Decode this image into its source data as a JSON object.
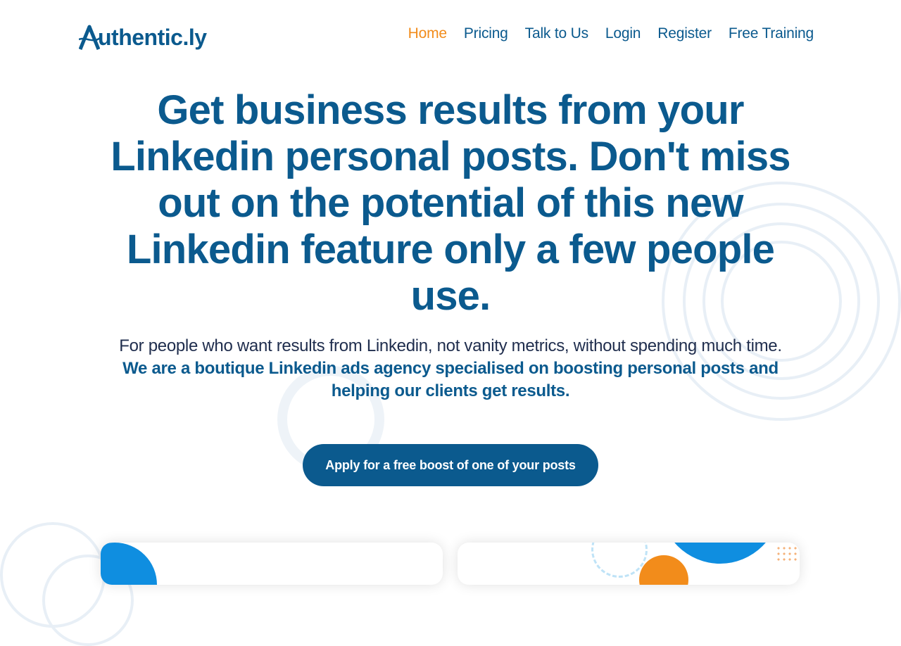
{
  "brand": {
    "name": "Authentic.ly",
    "logo_text_rest": "uthentic.ly",
    "logo_first_letter": "A",
    "primary_color": "#0b5a8e",
    "accent_color": "#f28c1b"
  },
  "nav": {
    "items": [
      {
        "label": "Home",
        "active": true
      },
      {
        "label": "Pricing",
        "active": false
      },
      {
        "label": "Talk to Us",
        "active": false
      },
      {
        "label": "Login",
        "active": false
      },
      {
        "label": "Register",
        "active": false
      },
      {
        "label": "Free Training",
        "active": false
      }
    ]
  },
  "hero": {
    "title": "Get business results from your Linkedin personal posts. Don't miss out on the potential of this new Linkedin feature only a few people use.",
    "subtitle": "For people who want results from Linkedin, not vanity metrics, without spending much time.",
    "tagline": "We are a boutique Linkedin ads agency specialised on boosting personal posts and helping our clients get results.",
    "cta_label": "Apply for a free boost of one of your posts"
  },
  "decorations": {
    "ring_color": "#e8eff6",
    "blue_shape_color": "#0f8ee0",
    "orange_shape_color": "#f28c1b",
    "icons": [
      "concentric-rings-decoration",
      "ring-decoration",
      "dotted-pattern-decoration"
    ]
  }
}
